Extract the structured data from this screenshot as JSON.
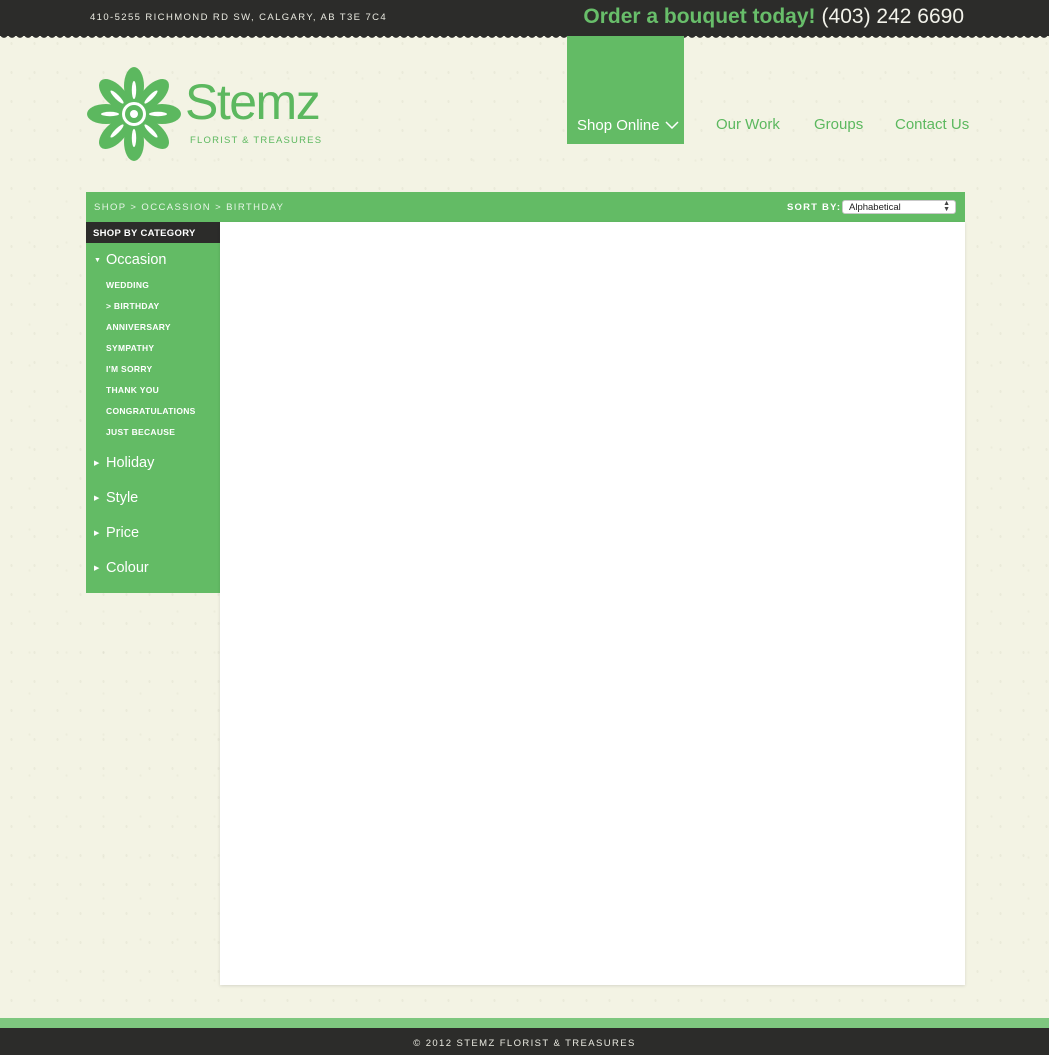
{
  "header": {
    "address": "410-5255 RICHMOND RD SW, CALGARY, AB T3E 7C4",
    "cta": "Order a bouquet today!",
    "phone": "(403) 242 6690"
  },
  "logo": {
    "name": "Stemz",
    "tagline": "FLORIST & TREASURES",
    "icon": "flower-icon"
  },
  "nav": {
    "items": [
      {
        "label": "Shop Online",
        "active": true
      },
      {
        "label": "Our Work"
      },
      {
        "label": "Groups"
      },
      {
        "label": "Contact Us"
      }
    ]
  },
  "breadcrumb": {
    "items": [
      "SHOP",
      "OCCASSION",
      "BIRTHDAY"
    ],
    "separator": ">"
  },
  "sort": {
    "label": "SORT BY:",
    "value": "Alphabetical"
  },
  "sidebar": {
    "heading": "SHOP BY CATEGORY",
    "categories": [
      {
        "label": "Occasion",
        "expanded": true
      },
      {
        "label": "Holiday"
      },
      {
        "label": "Style"
      },
      {
        "label": "Price"
      },
      {
        "label": "Colour"
      }
    ],
    "occasion_items": [
      "WEDDING",
      "> BIRTHDAY",
      "ANNIVERSARY",
      "SYMPATHY",
      "I'M SORRY",
      "THANK YOU",
      "CONGRATULATIONS",
      "JUST BECAUSE"
    ]
  },
  "footer": {
    "copyright": "© 2012 STEMZ FLORIST & TREASURES"
  },
  "colors": {
    "brand_green": "#63bb65",
    "dark": "#2c2c2a",
    "background": "#f3f3e4"
  }
}
